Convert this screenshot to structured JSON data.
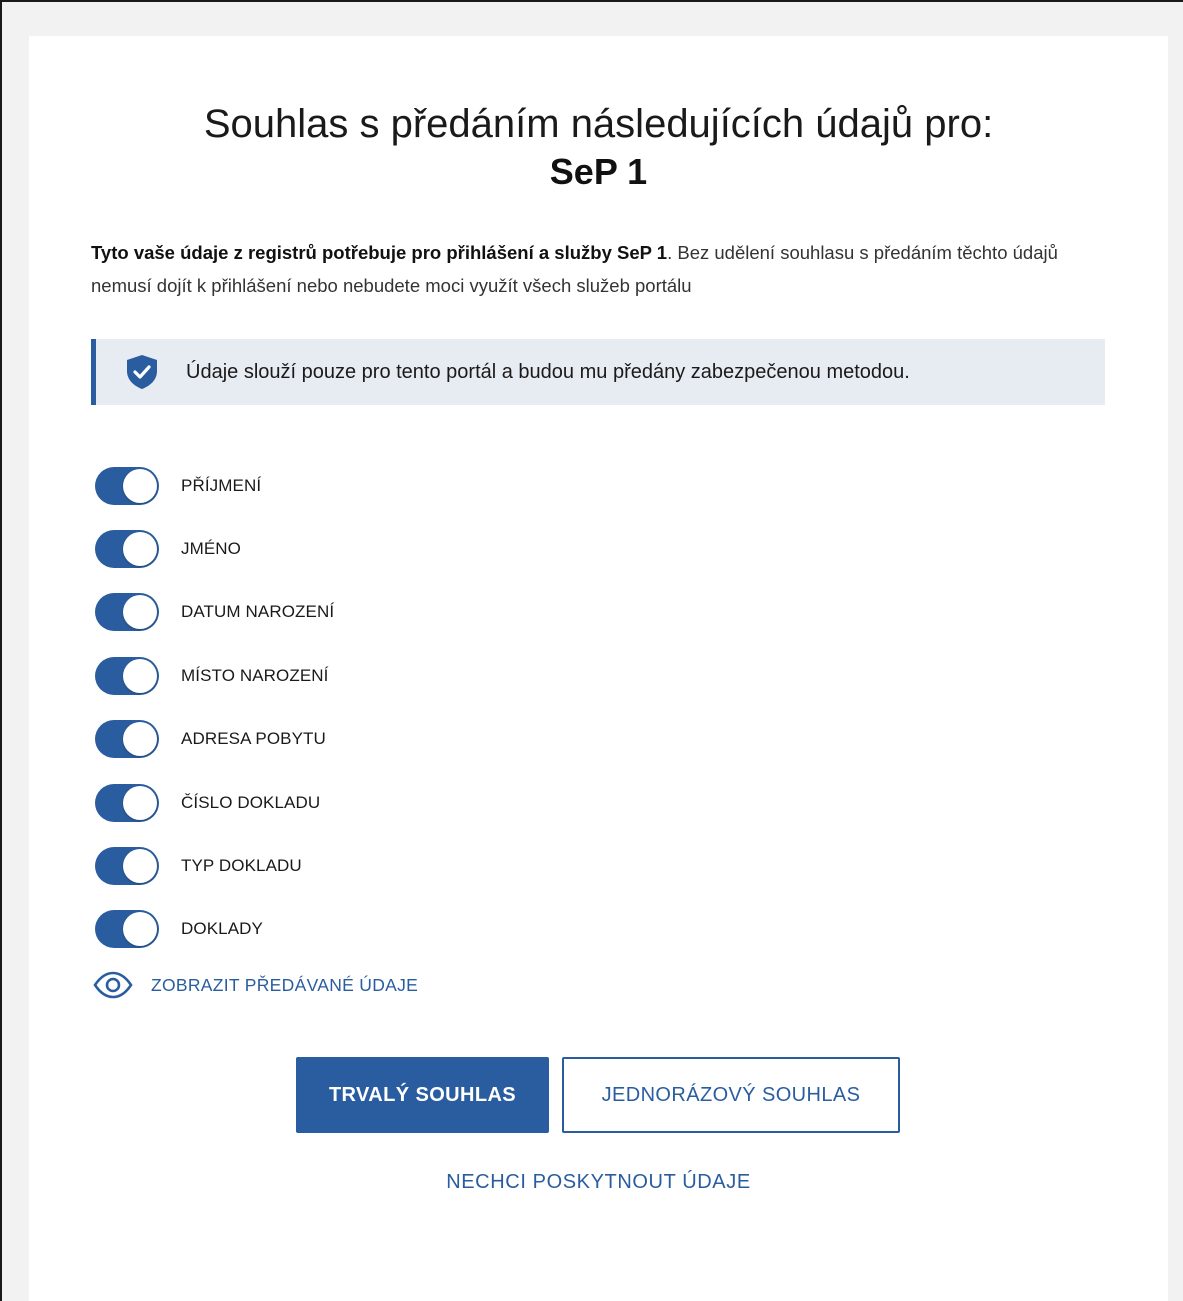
{
  "header": {
    "title": "Souhlas s předáním následujících údajů pro:",
    "service_name": "SeP 1"
  },
  "intro": {
    "bold": "Tyto vaše údaje z registrů potřebuje pro přihlášení a služby SeP 1",
    "rest": ". Bez udělení souhlasu s předáním těchto údajů nemusí dojít k přihlášení nebo nebudete moci využít všech služeb portálu"
  },
  "notice": {
    "icon": "shield-check-icon",
    "text": "Údaje slouží pouze pro tento portál a budou mu předány zabezpečenou metodou."
  },
  "toggles": [
    {
      "label": "PŘÍJMENÍ",
      "on": true
    },
    {
      "label": "JMÉNO",
      "on": true
    },
    {
      "label": "DATUM NAROZENÍ",
      "on": true
    },
    {
      "label": "MÍSTO NAROZENÍ",
      "on": true
    },
    {
      "label": "ADRESA POBYTU",
      "on": true
    },
    {
      "label": "ČÍSLO DOKLADU",
      "on": true
    },
    {
      "label": "TYP DOKLADU",
      "on": true
    },
    {
      "label": "DOKLADY",
      "on": true
    }
  ],
  "show_data": {
    "icon": "eye-icon",
    "label": "ZOBRAZIT PŘEDÁVANÉ ÚDAJE"
  },
  "actions": {
    "permanent_label": "TRVALÝ SOUHLAS",
    "one_time_label": "JEDNORÁZOVÝ SOUHLAS",
    "decline_label": "NECHCI POSKYTNOUT ÚDAJE"
  },
  "colors": {
    "accent": "#2a5d9f",
    "notice_bg": "#e7ebf2"
  }
}
